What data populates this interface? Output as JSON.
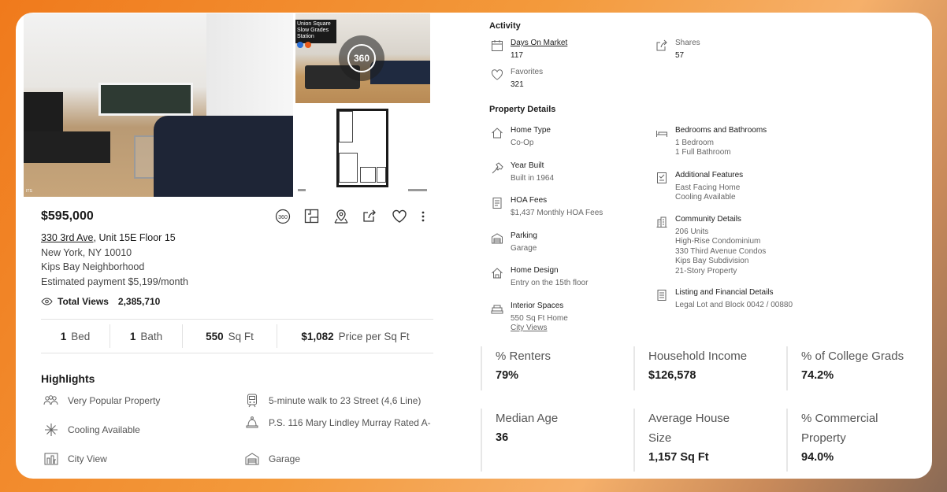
{
  "listing": {
    "price": "$595,000",
    "street": "330 3rd Ave",
    "unit": ", Unit 15E Floor 15",
    "city_line": "New York, NY 10010",
    "neighborhood": "Kips Bay Neighborhood",
    "estimated_payment": "Estimated payment $5,199/month",
    "total_views_label": "Total Views",
    "total_views": "2,385,710"
  },
  "media": {
    "pano_badge": "360",
    "pano_sign_lines": [
      "Union Square",
      "Slow Grades Station"
    ],
    "pano_chips": [
      "E",
      "F"
    ],
    "photo_credit": "ITS"
  },
  "actions": [
    "360-icon",
    "floorplan-icon",
    "map-pin-icon",
    "share-icon",
    "heart-icon",
    "more-icon"
  ],
  "stats": [
    {
      "value": "1",
      "label": "Bed"
    },
    {
      "value": "1",
      "label": "Bath"
    },
    {
      "value": "550",
      "label": "Sq Ft"
    },
    {
      "value": "$1,082",
      "label": "Price per Sq Ft"
    }
  ],
  "highlights": {
    "title": "Highlights",
    "items": [
      {
        "icon": "people-icon",
        "text": "Very Popular Property"
      },
      {
        "icon": "train-icon",
        "text": "5-minute walk to 23 Street (4,6 Line)"
      },
      {
        "icon": "snowflake-icon",
        "text": "Cooling Available"
      },
      {
        "icon": "school-bell-icon",
        "text": "P.S. 116 Mary Lindley Murray Rated A-"
      },
      {
        "icon": "city-view-icon",
        "text": "City View"
      },
      {
        "icon": "garage-icon",
        "text": "Garage"
      }
    ]
  },
  "activity": {
    "title": "Activity",
    "days_on_market": {
      "label": "Days On Market",
      "value": "117"
    },
    "shares": {
      "label": "Shares",
      "value": "57"
    },
    "favorites": {
      "label": "Favorites",
      "value": "321"
    }
  },
  "property_details": {
    "title": "Property Details",
    "left": [
      {
        "icon": "home-icon",
        "title": "Home Type",
        "lines": [
          "Co-Op"
        ]
      },
      {
        "icon": "hammer-icon",
        "title": "Year Built",
        "lines": [
          "Built in 1964"
        ]
      },
      {
        "icon": "receipt-icon",
        "title": "HOA Fees",
        "lines": [
          "$1,437 Monthly HOA Fees"
        ]
      },
      {
        "icon": "garage-icon",
        "title": "Parking",
        "lines": [
          "Garage"
        ]
      },
      {
        "icon": "home-design-icon",
        "title": "Home Design",
        "lines": [
          "Entry on the 15th floor"
        ]
      },
      {
        "icon": "sofa-icon",
        "title": "Interior Spaces",
        "lines": [
          "550 Sq Ft Home"
        ],
        "link": "City Views"
      }
    ],
    "right": [
      {
        "icon": "bed-icon",
        "title": "Bedrooms and Bathrooms",
        "lines": [
          "1 Bedroom",
          "1 Full Bathroom"
        ]
      },
      {
        "icon": "features-icon",
        "title": "Additional Features",
        "lines": [
          "East Facing Home",
          "Cooling Available"
        ]
      },
      {
        "icon": "building-icon",
        "title": "Community Details",
        "lines": [
          "206 Units",
          "High-Rise Condominium",
          "330 Third Avenue Condos",
          "Kips Bay Subdivision",
          "21-Story Property"
        ]
      },
      {
        "icon": "document-icon",
        "title": "Listing and Financial Details",
        "lines": [
          "Legal Lot and Block 0042 / 00880"
        ]
      }
    ]
  },
  "demographics": [
    {
      "label": "% Renters",
      "value": "79%"
    },
    {
      "label": "Household Income",
      "value": "$126,578"
    },
    {
      "label": "% of College Grads",
      "value": "74.2%"
    },
    {
      "label": "Median Age",
      "value": "36"
    },
    {
      "label": "Average House Size",
      "value": "1,157 Sq Ft"
    },
    {
      "label": "% Commercial Property",
      "value": "94.0%"
    }
  ],
  "colors": {
    "brand_background": "#f07a1c",
    "text_dark": "#1c1c1c",
    "text_muted": "#555555"
  }
}
